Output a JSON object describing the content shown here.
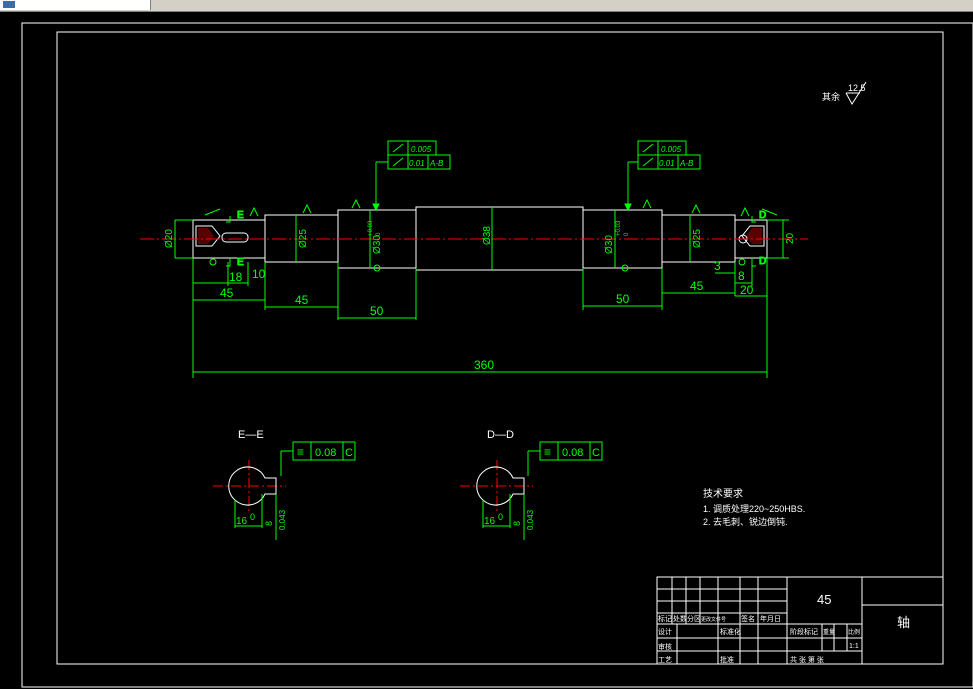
{
  "app": {
    "tab_label": ""
  },
  "colors": {
    "frame": "#ffffff",
    "dim": "#00ff00",
    "part": "#ffffff",
    "center": "#ff0000",
    "text": "#ffffff",
    "gdt": "#00ff00"
  },
  "roughness": {
    "rest_label": "其余",
    "rest_value": "12.5"
  },
  "main_view": {
    "dims": {
      "d20_left": "Ø20",
      "d25_left": "Ø25",
      "d30_left": "Ø30",
      "d38": "Ø38",
      "d30_right": "Ø30",
      "d25_right": "Ø25",
      "d20_right": "20",
      "tol_upper": "+0.03",
      "tol_lower": "0",
      "l18": "18",
      "l10": "10",
      "l45_a": "45",
      "l45_b": "45",
      "l50_a": "50",
      "l50_b": "50",
      "l45_c": "45",
      "l3": "3",
      "l8": "8",
      "l20": "20",
      "l360": "360"
    },
    "section_marks": {
      "left_top": "E",
      "left_bottom": "E",
      "right_top": "D",
      "right_bottom": "D"
    },
    "gdt_left": {
      "t1": "0.005",
      "t2": "0.01",
      "datum": "A-B"
    },
    "gdt_right": {
      "t1": "0.005",
      "t2": "0.01",
      "datum": "A-B"
    }
  },
  "section_e": {
    "title": "E—E",
    "sym": "≡",
    "tol": "0.08",
    "datum": "C",
    "d1": "16",
    "d2": "0",
    "d3": "8",
    "d4": "0.043"
  },
  "section_d": {
    "title": "D—D",
    "sym": "≡",
    "tol": "0.08",
    "datum": "C",
    "d1": "16",
    "d2": "0",
    "d3": "8",
    "d4": "0.043"
  },
  "tech": {
    "heading": "技术要求",
    "line1": "1. 调质处理220~250HBS.",
    "line2": "2. 去毛刺、锐边倒钝."
  },
  "title_block": {
    "material": "45",
    "part_name": "轴",
    "row_header": [
      "标记",
      "处数",
      "分区",
      "更改文件号",
      "签名",
      "年月日"
    ],
    "designer": "设计",
    "standard": "标准化",
    "checker": "审核",
    "process": "工艺",
    "approve": "批准",
    "stage_label": "阶段标记",
    "weight_label": "重量",
    "scale_label": "比例",
    "scale": "1:1",
    "sheets": "共 张  第 张"
  }
}
